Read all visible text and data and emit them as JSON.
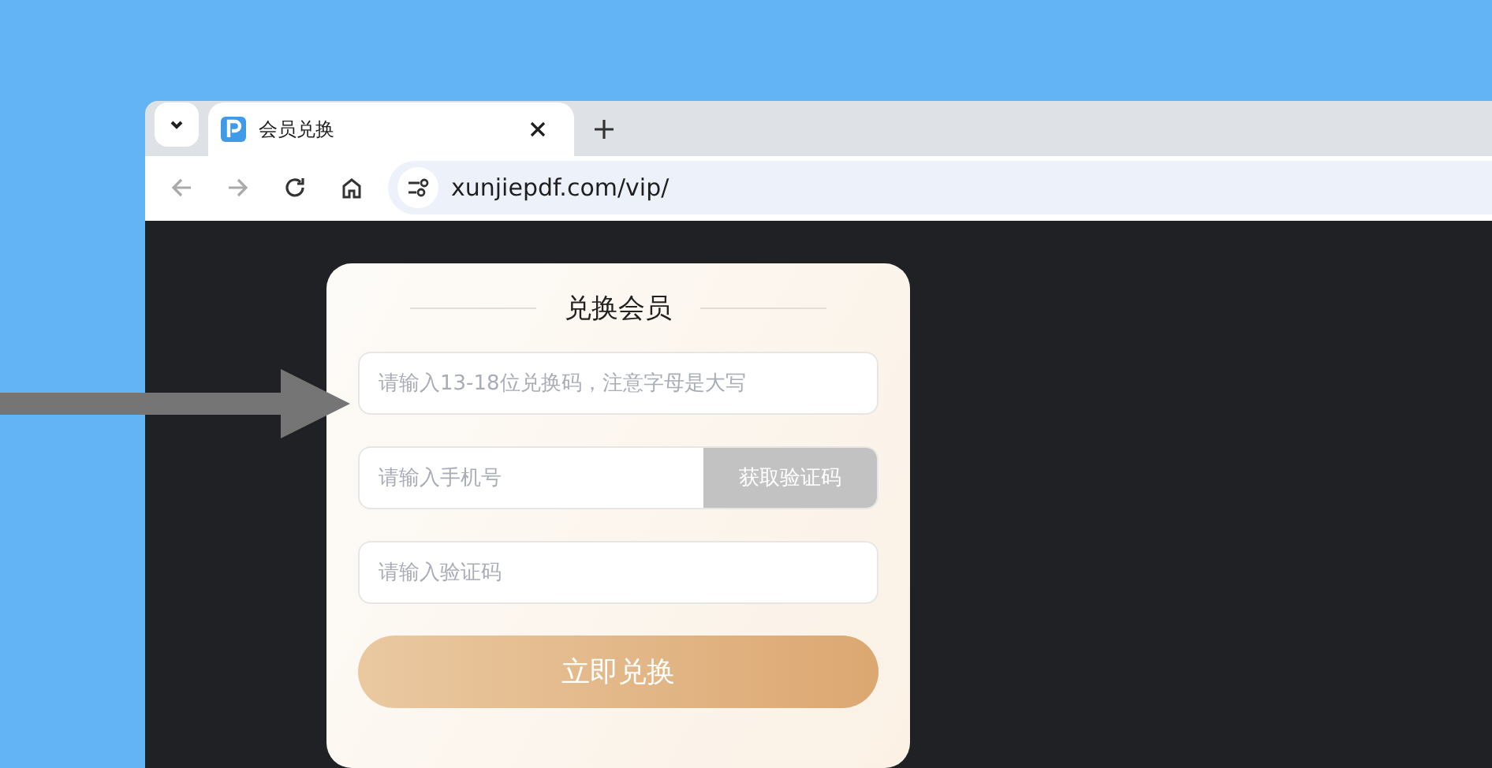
{
  "browser": {
    "tab": {
      "title": "会员兑换",
      "selected": true
    },
    "url": "xunjiepdf.com/vip/"
  },
  "card": {
    "title": "兑换会员",
    "fields": [
      {
        "kind": "plain",
        "placeholder": "请输入13-18位兑换码，注意字母是大写"
      },
      {
        "kind": "with_button",
        "placeholder": "请输入手机号",
        "button": "获取验证码"
      },
      {
        "kind": "plain",
        "placeholder": "请输入验证码"
      }
    ],
    "submit": "立即兑换"
  }
}
